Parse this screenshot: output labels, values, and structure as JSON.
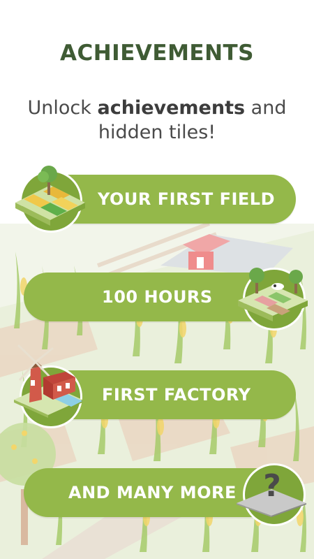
{
  "header": {
    "title": "ACHIEVEMENTS",
    "subtitle_prefix": "Unlock ",
    "subtitle_bold": "achievements",
    "subtitle_suffix": " and",
    "subtitle_line2": "hidden tiles!"
  },
  "achievements": [
    {
      "label": "YOUR FIRST FIELD",
      "icon": "wheat-field-tile-icon"
    },
    {
      "label": "100 HOURS",
      "icon": "garden-farm-tile-icon"
    },
    {
      "label": "FIRST FACTORY",
      "icon": "windmill-factory-tile-icon"
    },
    {
      "label": "AND MANY MORE",
      "icon": "question-mark-tile-icon"
    }
  ],
  "colors": {
    "pill": "#94b84a",
    "title": "#3f5b34",
    "corn_leaf": "#a6cb6a",
    "corn_cob": "#f3d66b"
  }
}
